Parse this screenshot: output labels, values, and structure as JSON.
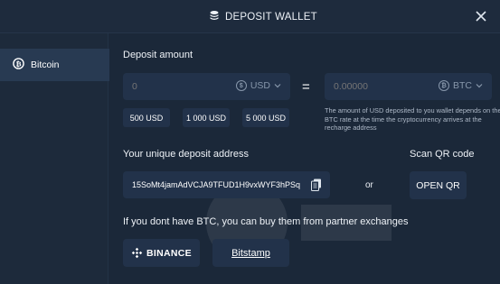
{
  "header": {
    "title": "DEPOSIT WALLET",
    "icon": "coins-icon",
    "close": "close-icon"
  },
  "sidebar": {
    "items": [
      {
        "label": "Bitcoin",
        "icon": "bitcoin-icon"
      }
    ]
  },
  "deposit": {
    "label": "Deposit amount",
    "amount_placeholder": "0",
    "amount_currency": "USD",
    "equals": "=",
    "btc_placeholder": "0.00000",
    "btc_currency": "BTC",
    "presets": [
      "500 USD",
      "1 000 USD",
      "5 000 USD"
    ],
    "note": "The amount of USD deposited to you wallet depends on the BTC rate at the time the cryptocurrency arrives at the recharge address"
  },
  "address": {
    "label": "Your unique deposit address",
    "value": "15SoMt4jamAdVCJA9TFUD1H9vxWYF3hPSq",
    "or": "or",
    "qr_label": "Scan QR code",
    "qr_button": "OPEN QR"
  },
  "exchanges": {
    "label": "If you dont have BTC, you can buy them from partner exchanges",
    "binance": "BINANCE",
    "bitstamp": "Bitstamp"
  },
  "colors": {
    "background": "#1b2839",
    "panel": "#22324a",
    "accent": "#283a52"
  }
}
